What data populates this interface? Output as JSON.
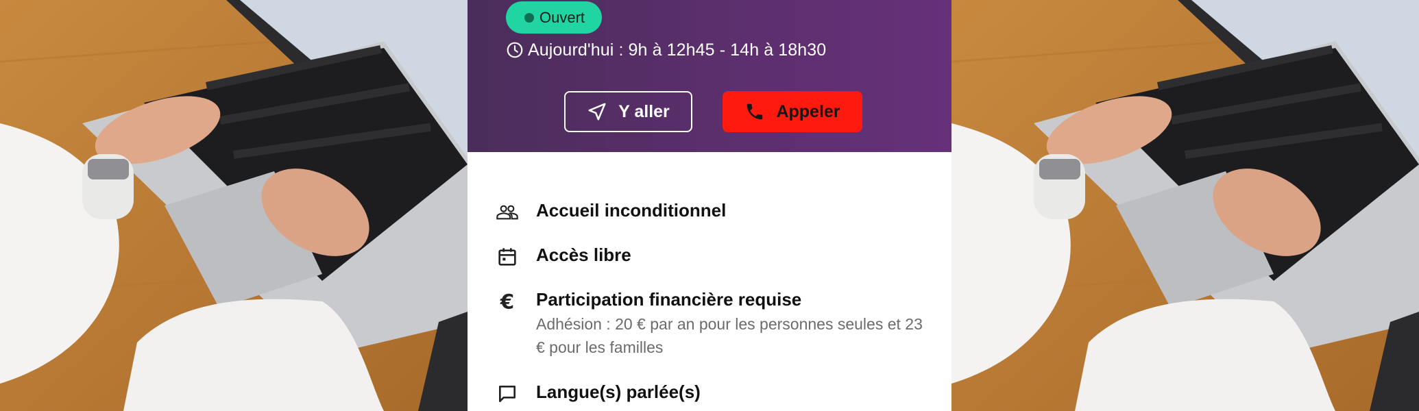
{
  "status": {
    "open_label": "Ouvert",
    "today_hours": "Aujourd'hui : 9h à 12h45 - 14h à 18h30"
  },
  "actions": {
    "go_label": "Y aller",
    "call_label": "Appeler"
  },
  "features": [
    {
      "icon": "people-icon",
      "title": "Accueil inconditionnel",
      "description": ""
    },
    {
      "icon": "calendar-icon",
      "title": "Accès libre",
      "description": ""
    },
    {
      "icon": "euro-icon",
      "title": "Participation financière requise",
      "description": "Adhésion : 20 € par an pour les personnes seules et 23 € pour les familles"
    },
    {
      "icon": "chat-bubble-icon",
      "title": "Langue(s) parlée(s)",
      "description": ""
    }
  ],
  "colors": {
    "hero_start": "#4a2d5a",
    "hero_end": "#66307a",
    "open_badge": "#21d5a3",
    "call_button": "#ff1a10"
  }
}
